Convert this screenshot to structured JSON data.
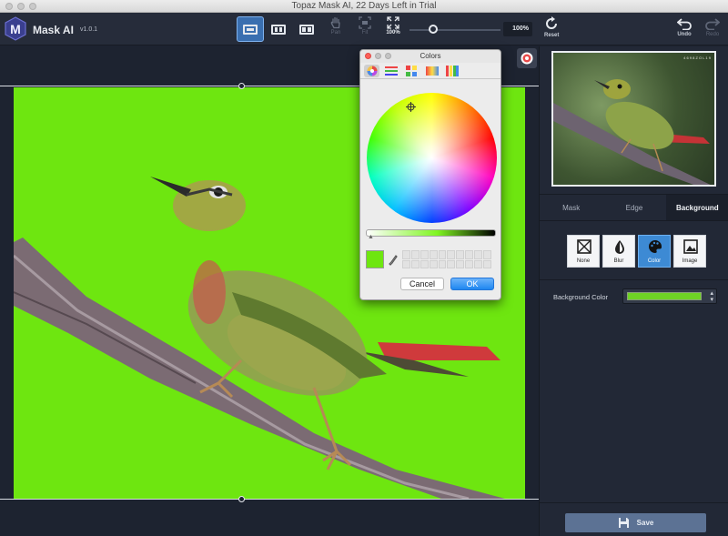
{
  "window": {
    "title": "Topaz Mask AI, 22 Days Left in Trial"
  },
  "app": {
    "name": "Mask AI",
    "version": "v1.0.1"
  },
  "toolbar": {
    "pan_label": "Pan",
    "fit_label": "Fit",
    "actual_label": "100%",
    "zoom_value": "100%",
    "reset_label": "Reset",
    "undo_label": "Undo",
    "redo_label": "Redo"
  },
  "preview": {
    "thumb_caption": "4 6 9 8  Z O L 1 9"
  },
  "panel": {
    "tabs": [
      {
        "label": "Mask",
        "active": false
      },
      {
        "label": "Edge",
        "active": false
      },
      {
        "label": "Background",
        "active": true
      }
    ],
    "options": [
      {
        "label": "None",
        "icon": "none-icon",
        "active": false
      },
      {
        "label": "Blur",
        "icon": "blur-icon",
        "active": false
      },
      {
        "label": "Color",
        "icon": "palette-icon",
        "active": true
      },
      {
        "label": "Image",
        "icon": "image-icon",
        "active": false
      }
    ],
    "background_color_label": "Background Color",
    "background_color": "#6fd325",
    "save_label": "Save"
  },
  "colors_dialog": {
    "title": "Colors",
    "current_color": "#6ee610",
    "cancel_label": "Cancel",
    "ok_label": "OK"
  },
  "colors": {
    "canvas_bg": "#6ee610",
    "accent": "#3a6fb0"
  }
}
